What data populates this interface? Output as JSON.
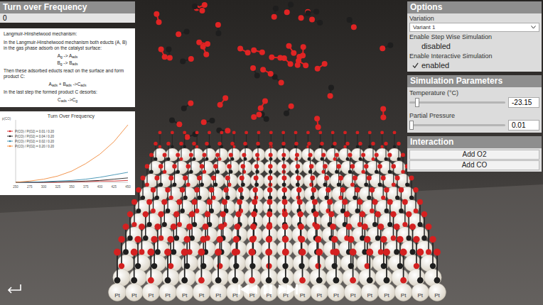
{
  "left_panel": {
    "title": "Turn over Frequency",
    "value": "0",
    "description": {
      "heading": "Langmuir-Hinshelwood mechanism:",
      "blocks": [
        {
          "kind": "text",
          "text": "In the Langmuir-Hinshelwood mechanism both educts (A, B) in the gas phase adsorb on the catalyst surface:"
        },
        {
          "kind": "formula",
          "parts": [
            {
              "text": "A",
              "sub": false
            },
            {
              "text": "g",
              "sub": true
            },
            {
              "text": " -> ",
              "sub": false
            },
            {
              "text": "A",
              "sub": false
            },
            {
              "text": "ads",
              "sub": true
            }
          ]
        },
        {
          "kind": "formula",
          "parts": [
            {
              "text": "B",
              "sub": false
            },
            {
              "text": "g",
              "sub": true
            },
            {
              "text": " -> ",
              "sub": false
            },
            {
              "text": "B",
              "sub": false
            },
            {
              "text": "ads",
              "sub": true
            }
          ]
        },
        {
          "kind": "text",
          "text": "Then these adsorbed educts react on the surface and form product C:"
        },
        {
          "kind": "formula",
          "parts": [
            {
              "text": "A",
              "sub": false
            },
            {
              "text": "ads",
              "sub": true
            },
            {
              "text": " + ",
              "sub": false
            },
            {
              "text": "B",
              "sub": false
            },
            {
              "text": "ads",
              "sub": true
            },
            {
              "text": " ->",
              "sub": false
            },
            {
              "text": "C",
              "sub": false
            },
            {
              "text": "ads",
              "sub": true
            }
          ]
        },
        {
          "kind": "text",
          "text": "In the last step the formed product C desorbs:"
        },
        {
          "kind": "formula",
          "parts": [
            {
              "text": "C",
              "sub": false
            },
            {
              "text": "ads",
              "sub": true
            },
            {
              "text": " ->",
              "sub": false
            },
            {
              "text": "C",
              "sub": false
            },
            {
              "text": "g",
              "sub": true
            }
          ]
        }
      ]
    },
    "chart": {
      "title": "Turn Over Frequency",
      "y_label": "p(CO)",
      "x_ticks": [
        "250",
        "275",
        "300",
        "325",
        "350",
        "375",
        "400",
        "425",
        "450"
      ],
      "series": [
        {
          "label": "P(CO) / P(O2) = 0.01 / 0.20",
          "color": "#d62728",
          "values": [
            0,
            0,
            0,
            0,
            1,
            1,
            2,
            2,
            3
          ]
        },
        {
          "label": "P(CO) / P(O2) = 0.04 / 0.20",
          "color": "#222222",
          "values": [
            0,
            0,
            0,
            1,
            1,
            2,
            3,
            5,
            7
          ]
        },
        {
          "label": "P(CO) / P(O2) = 0.02 / 0.20",
          "color": "#3b8fb0",
          "values": [
            0,
            0,
            1,
            2,
            3,
            5,
            8,
            12,
            16
          ]
        },
        {
          "label": "P(CO) / P(O2) = 0.20 / 0.20",
          "color": "#f08a3c",
          "values": [
            0,
            2,
            5,
            10,
            18,
            30,
            45,
            65,
            92
          ]
        }
      ]
    }
  },
  "options": {
    "title": "Options",
    "variation": {
      "label": "Variation",
      "value": "Variant 1"
    },
    "toggles": [
      {
        "label": "Enable Step Wise Simulation",
        "state_text": "disabled",
        "checked": false
      },
      {
        "label": "Enable Interactive Simulation",
        "state_text": "enabled",
        "checked": true
      }
    ]
  },
  "simulation_parameters": {
    "title": "Simulation Parameters",
    "sliders": [
      {
        "label": "Temperature (°C)",
        "value": "-23.15",
        "level": 0.08
      },
      {
        "label": "Partial Pressure",
        "value": "0.01",
        "level": 0.02
      }
    ]
  },
  "interaction": {
    "title": "Interaction",
    "buttons": [
      "Add O2",
      "Add CO"
    ]
  },
  "scene": {
    "surface_label": "Pt"
  }
}
